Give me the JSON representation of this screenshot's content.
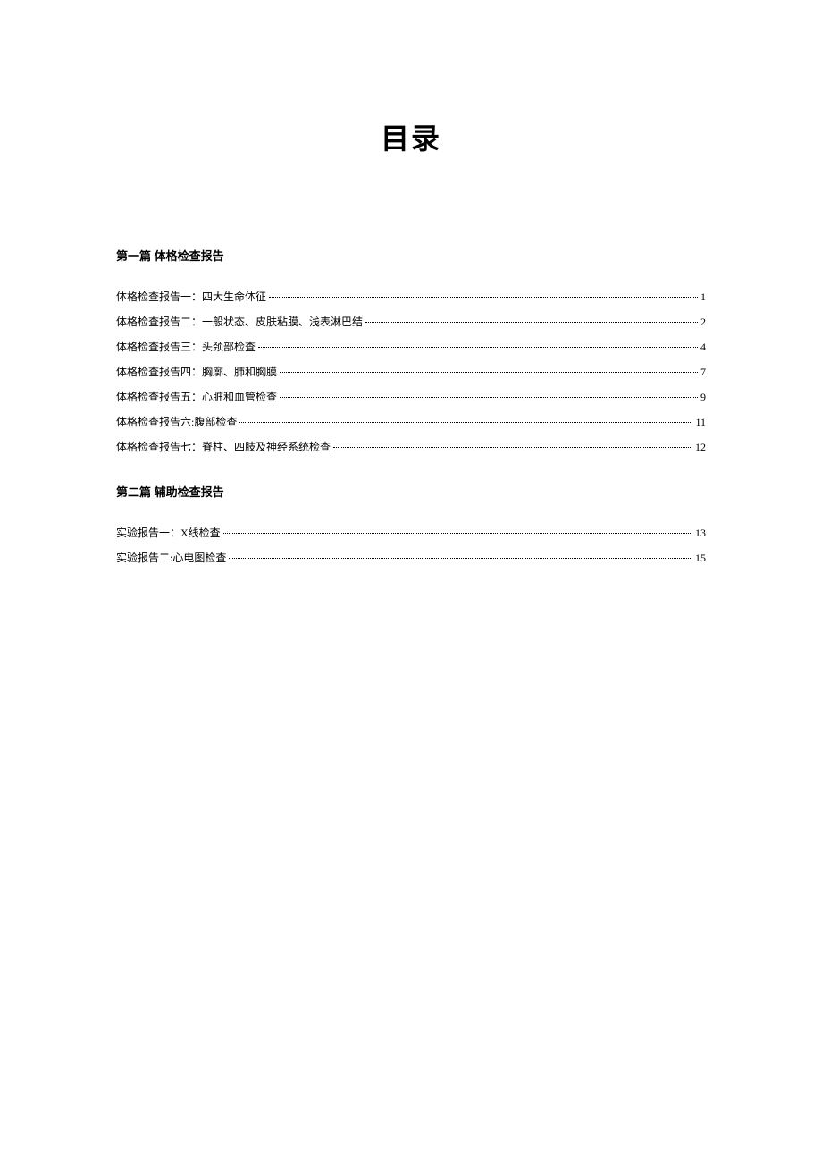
{
  "title": "目录",
  "sections": [
    {
      "header": "第一篇  体格检查报告",
      "entries": [
        {
          "label": "体格检查报告一：四大生命体征",
          "page": "1"
        },
        {
          "label": "体格检查报告二：一般状态、皮肤粘膜、浅表淋巴结",
          "page": "2"
        },
        {
          "label": "体格检查报告三：头颈部检查",
          "page": "4"
        },
        {
          "label": "体格检查报告四：胸廓、肺和胸膜",
          "page": "7"
        },
        {
          "label": "体格检查报告五：心脏和血管检查",
          "page": "9"
        },
        {
          "label": "体格检查报告六:腹部检查",
          "page": "11"
        },
        {
          "label": "体格检查报告七：脊柱、四肢及神经系统检查",
          "page": "12"
        }
      ]
    },
    {
      "header": "第二篇  辅助检查报告",
      "entries": [
        {
          "label": "实验报告一：X线检查",
          "page": "13"
        },
        {
          "label": "实验报告二:心电图检查",
          "page": "15"
        }
      ]
    }
  ]
}
